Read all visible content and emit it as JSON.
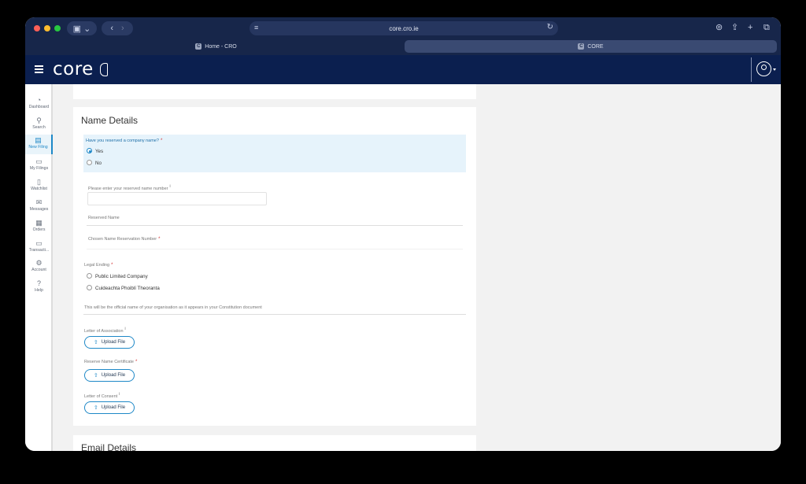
{
  "browser": {
    "url": "core.cro.ie",
    "tabs": [
      {
        "label": "Home - CRO",
        "active": false
      },
      {
        "label": "CORE",
        "active": true
      }
    ],
    "colors": {
      "titlebar": "#17264a",
      "close": "#ff5f57",
      "minimize": "#febc2e",
      "maximize": "#28c840"
    }
  },
  "app": {
    "logo": "core",
    "sidebar": [
      {
        "label": "Dashboard",
        "icon": "dashboard-icon",
        "glyph": "◔"
      },
      {
        "label": "Search",
        "icon": "search-icon",
        "glyph": "⚲"
      },
      {
        "label": "New Filing",
        "icon": "new-filing-icon",
        "glyph": "▤",
        "active": true
      },
      {
        "label": "My Filings",
        "icon": "folder-icon",
        "glyph": "▭"
      },
      {
        "label": "Watchlist",
        "icon": "watchlist-icon",
        "glyph": "▯"
      },
      {
        "label": "Messages",
        "icon": "mail-icon",
        "glyph": "✉"
      },
      {
        "label": "Orders",
        "icon": "orders-icon",
        "glyph": "▦"
      },
      {
        "label": "Transacti...",
        "icon": "wallet-icon",
        "glyph": "▭"
      },
      {
        "label": "Account",
        "icon": "gear-icon",
        "glyph": "⚙"
      },
      {
        "label": "Help",
        "icon": "help-icon",
        "glyph": "?"
      }
    ]
  },
  "name_details": {
    "title": "Name Details",
    "reserved_question": "Have you reserved a company name?",
    "reserved_options": [
      {
        "label": "Yes",
        "checked": true
      },
      {
        "label": "No",
        "checked": false
      }
    ],
    "reserved_number_label": "Please enter your reserved name number",
    "reserved_name_label": "Reserved Name",
    "chosen_reservation_label": "Chosen Name Reservation Number",
    "legal_ending_label": "Legal Ending",
    "legal_ending_options": [
      "Public Limited Company",
      "Cuideachta Phoiblí Theoranta"
    ],
    "official_name_note": "This will be the official name of your organisation as it appears in your Constitution document",
    "letter_of_association_label": "Letter of Association",
    "reserve_cert_label": "Reserve Name Certificate",
    "letter_of_consent_label": "Letter of Consent",
    "upload_label": "Upload File"
  },
  "email_details": {
    "title": "Email Details"
  },
  "required_mark": "*",
  "info_mark": "i"
}
